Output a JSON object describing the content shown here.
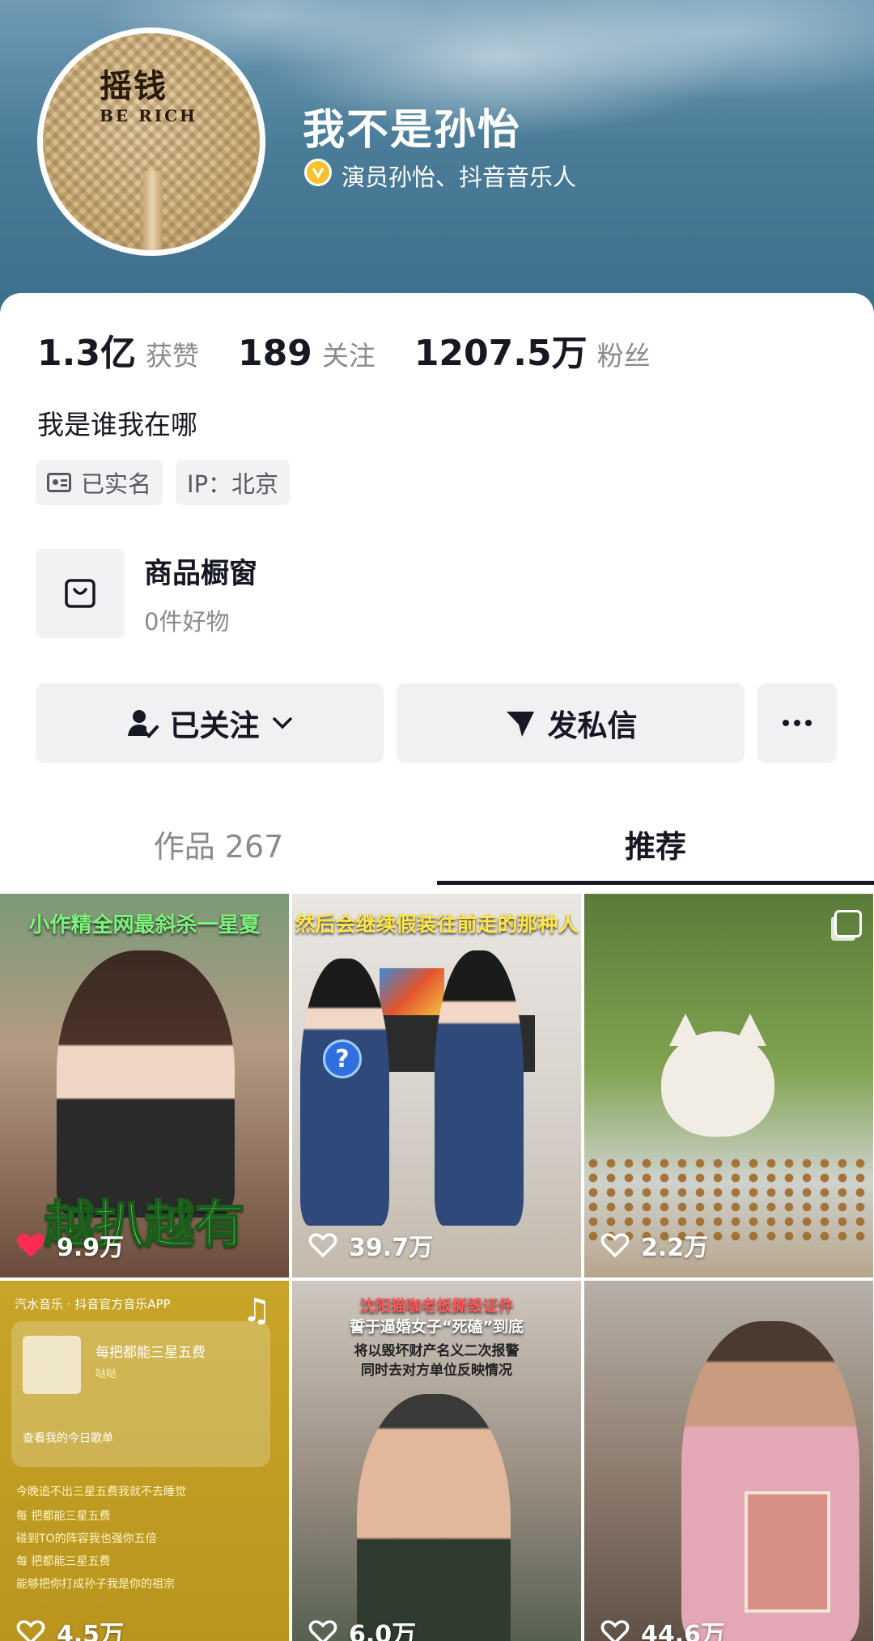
{
  "profile": {
    "display_name": "我不是孙怡",
    "verified_text": "演员孙怡、抖音音乐人",
    "avatar_text_big": "摇钱",
    "avatar_text_small": "BE RICH"
  },
  "stats": [
    {
      "num": "1.3亿",
      "label": "获赞"
    },
    {
      "num": "189",
      "label": "关注"
    },
    {
      "num": "1207.5万",
      "label": "粉丝"
    }
  ],
  "bio": "我是谁我在哪",
  "tags": {
    "realname": "已实名",
    "ip": "IP：北京"
  },
  "shop": {
    "title": "商品橱窗",
    "subtitle": "0件好物"
  },
  "actions": {
    "follow": "已关注",
    "message": "发私信"
  },
  "tabs": {
    "works": "作品 267",
    "recommend": "推荐"
  },
  "tiles": [
    {
      "likes": "9.9万",
      "caption": "越扒越有",
      "top_caption": "小作精全网最斜杀一星夏",
      "liked": true
    },
    {
      "likes": "39.7万",
      "caption": "然后会继续假装往前走的那种人",
      "liked": false
    },
    {
      "likes": "2.2万",
      "liked": false
    },
    {
      "likes": "4.5万",
      "header": "汽水音乐 · 抖音官方音乐APP",
      "song": "每把都能三星五费",
      "artist": "哒哒",
      "playlist": "查看我的今日歌单",
      "lyrics": [
        "今晚追不出三星五费我就不去睡觉",
        "每 把都能三星五费",
        "碰到TO的阵容我也强你五倍",
        "每 把都能三星五费",
        "能够把你打成孙子我是你的祖宗"
      ],
      "liked": false
    },
    {
      "likes": "6.0万",
      "caption_lines": [
        "沈阳猫咖老板撕毁证件",
        "誓于逼婚女子“死磕”到底",
        "将以毁坏财产名义二次报警",
        "同时去对方单位反映情况"
      ],
      "liked": false
    },
    {
      "likes": "44.6万",
      "liked": false
    }
  ]
}
